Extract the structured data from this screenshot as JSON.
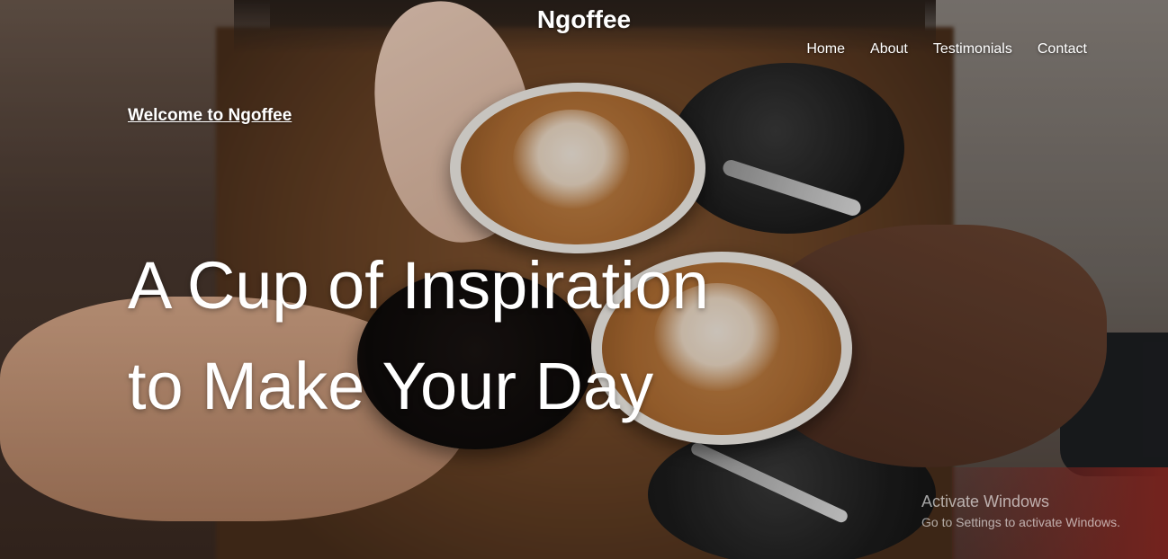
{
  "brand": {
    "name": "Ngoffee"
  },
  "nav": {
    "items": [
      {
        "label": "Home"
      },
      {
        "label": "About"
      },
      {
        "label": "Testimonials"
      },
      {
        "label": "Contact"
      }
    ]
  },
  "hero": {
    "welcome": "Welcome to Ngoffee",
    "headline_line1": "A Cup of Inspiration",
    "headline_line2": "to Make Your Day",
    "background": "coffee-cups-toast-photo"
  },
  "watermark": {
    "title": "Activate Windows",
    "subtitle": "Go to Settings to activate Windows."
  }
}
